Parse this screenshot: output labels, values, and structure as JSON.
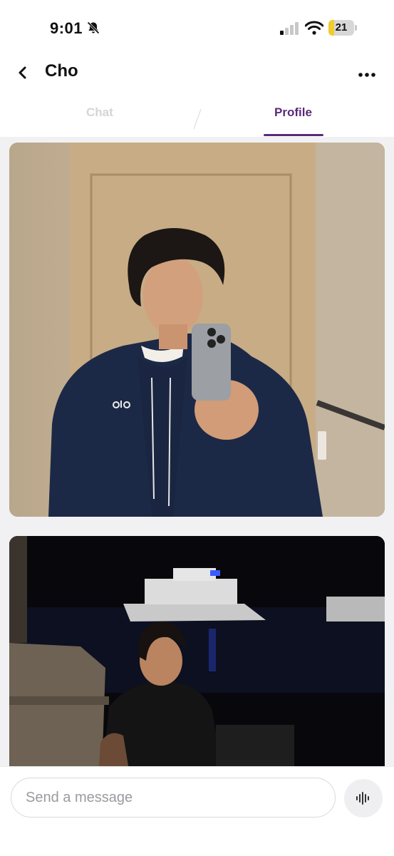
{
  "status_bar": {
    "time": "9:01",
    "battery_level": "21",
    "battery_fraction": 0.21,
    "icons": [
      "bell-slash-icon",
      "cellular-signal-icon",
      "wifi-icon",
      "battery-icon"
    ]
  },
  "header": {
    "title": "Cho",
    "back_icon": "chevron-left-icon",
    "more_icon": "more-dots-icon"
  },
  "tabs": [
    {
      "label": "Chat",
      "active": false
    },
    {
      "label": "Profile",
      "active": true
    }
  ],
  "photos": [
    {
      "name": "profile-photo-1",
      "description_visible": false
    },
    {
      "name": "profile-photo-2",
      "description_visible": false
    }
  ],
  "composer": {
    "placeholder": "Send a message",
    "value": "",
    "voice_icon": "waveform-icon"
  },
  "colors": {
    "accent": "#5b2a7a",
    "inactive_tab": "#d5d5d8",
    "content_background": "#f1f1f3",
    "battery_fill": "#f2cb2d"
  }
}
